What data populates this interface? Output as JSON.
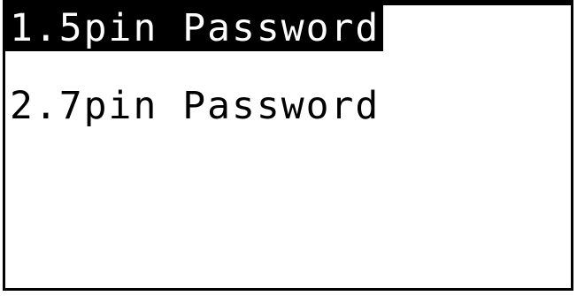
{
  "menu": {
    "items": [
      {
        "label": "1.5pin Password",
        "selected": true
      },
      {
        "label": "2.7pin Password",
        "selected": false
      }
    ]
  },
  "colors": {
    "background": "#ffffff",
    "foreground": "#000000",
    "highlight": "#000000",
    "highlight_text": "#ffffff"
  }
}
